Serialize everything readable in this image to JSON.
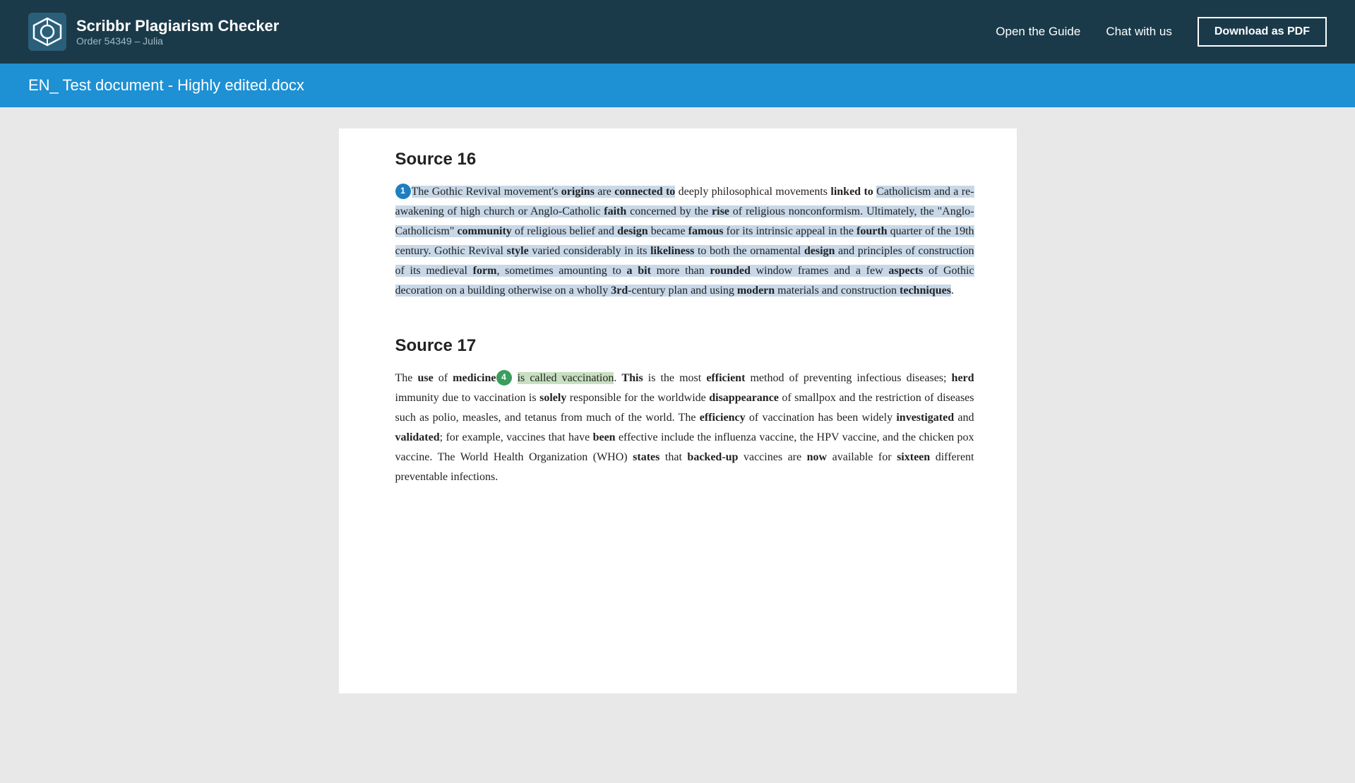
{
  "header": {
    "logo_title": "Scribbr Plagiarism Checker",
    "logo_subtitle": "Order 54349 – Julia",
    "nav_guide": "Open the Guide",
    "nav_chat": "Chat with us",
    "download_btn": "Download as PDF"
  },
  "file_title": "EN_ Test document - Highly edited.docx",
  "sources": [
    {
      "id": "source16",
      "title": "Source 16",
      "badge_number": "1",
      "badge_color": "blue",
      "paragraphs": []
    },
    {
      "id": "source17",
      "title": "Source 17",
      "badge_number": "4",
      "badge_color": "green",
      "paragraphs": []
    }
  ]
}
